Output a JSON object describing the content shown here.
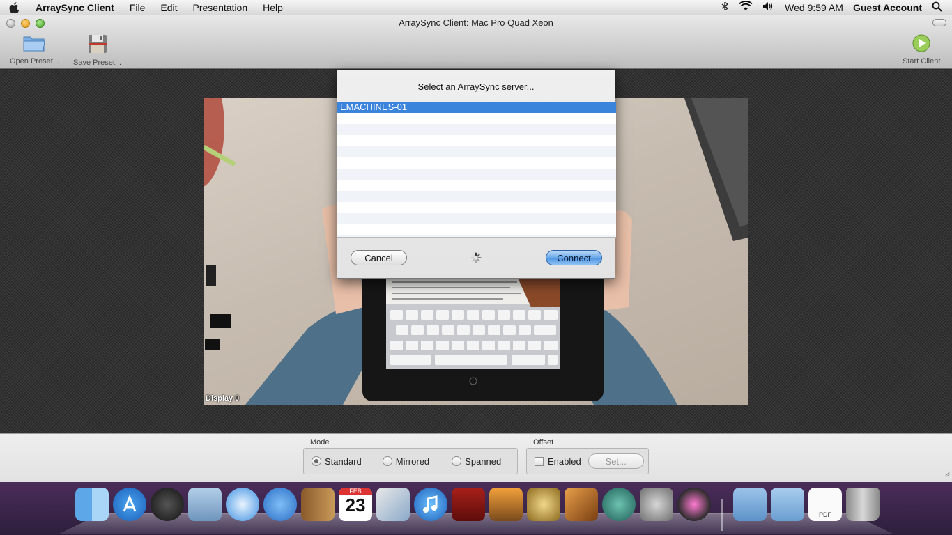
{
  "menubar": {
    "app_name": "ArraySync Client",
    "menus": [
      "File",
      "Edit",
      "Presentation",
      "Help"
    ],
    "clock": "Wed 9:59 AM",
    "user": "Guest Account"
  },
  "window": {
    "title": "ArraySync Client: Mac Pro Quad Xeon",
    "toolbar": {
      "open_preset": "Open Preset...",
      "save_preset": "Save Preset...",
      "start_client": "Start Client"
    },
    "display_label": "Display 0"
  },
  "bottom_panel": {
    "mode": {
      "title": "Mode",
      "options": [
        "Standard",
        "Mirrored",
        "Spanned"
      ],
      "selected": "Standard"
    },
    "offset": {
      "title": "Offset",
      "enabled_label": "Enabled",
      "enabled": false,
      "set_label": "Set..."
    }
  },
  "dialog": {
    "title": "Select an ArraySync server...",
    "servers": [
      "EMACHINES-01"
    ],
    "selected_server": "EMACHINES-01",
    "cancel_label": "Cancel",
    "connect_label": "Connect"
  },
  "dock": {
    "apps": [
      "finder",
      "app-store",
      "dashboard",
      "mail",
      "safari",
      "facetime",
      "address-book",
      "ical",
      "preview",
      "itunes",
      "photo-booth",
      "iphoto",
      "imovie",
      "garageband",
      "time-machine",
      "system-preferences",
      "launchpad"
    ],
    "folders": [
      "applications",
      "documents",
      "downloads"
    ],
    "calendar_month": "FEB",
    "calendar_day": "23",
    "doc_label": "PDF"
  }
}
